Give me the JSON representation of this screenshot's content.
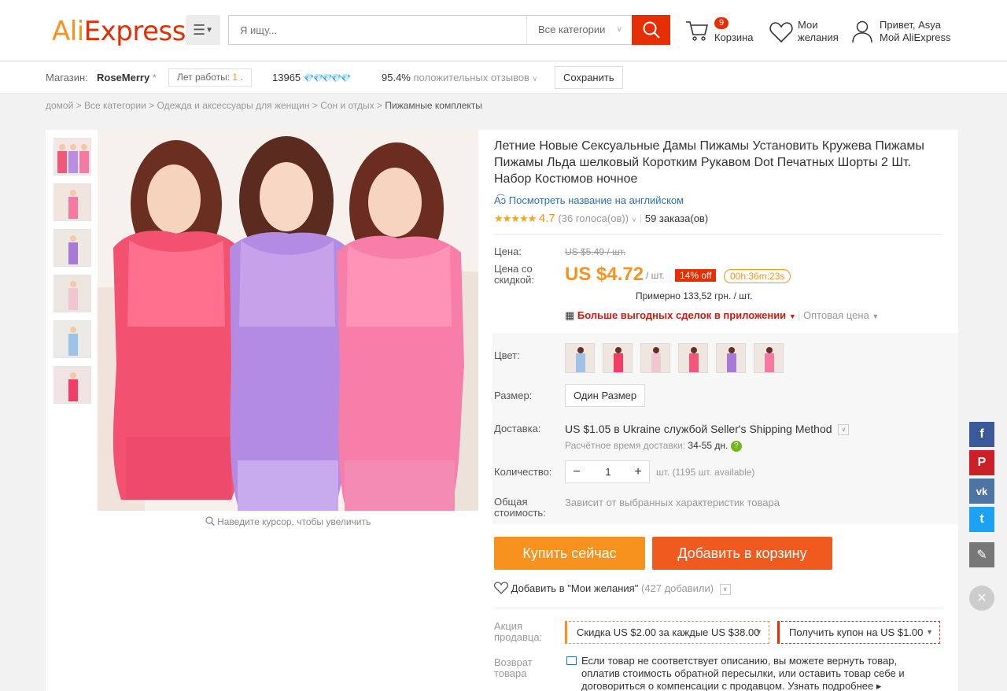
{
  "header": {
    "logo_ali": "Ali",
    "logo_express": "Express",
    "logo_tm": "™",
    "search_placeholder": "Я ищу...",
    "search_category": "Все категории",
    "cart_count": "9",
    "cart_label": "Корзина",
    "wishlist_line1": "Мои",
    "wishlist_line2": "желания",
    "account_line1": "Привет, Asya",
    "account_line2": "Мой AliExpress"
  },
  "store": {
    "label": "Магазин:",
    "name": "RoseMerry",
    "star": "*",
    "years_label": "Лет работы:",
    "years_value": "1",
    "years_dot": ".",
    "score": "13965",
    "diamonds": "💎💎💎💎💎",
    "positive": "95.4%",
    "positive_label": "положительных отзывов",
    "save_label": "Сохранить"
  },
  "breadcrumb": [
    "домой",
    "Все категории",
    "Одежда и аксессуары для женщин",
    "Сон и отдых",
    "Пижамные комплекты"
  ],
  "gallery": {
    "zoom_hint": "Наведите курсор, чтобы увеличить"
  },
  "product": {
    "title": "Летние Новые Сексуальные Дамы Пижамы Установить Кружева Пижамы Пижамы Льда шелковый Коротким Рукавом Dot Печатных Шорты 2 Шт. Набор Костюмов ночное",
    "translate_link": "Посмотреть название на английском",
    "stars": "★★★★★",
    "rating": "4.7",
    "votes": "(36 голоса(ов))",
    "orders": "59 заказа(ов)",
    "price_label": "Цена:",
    "old_price": "US $5.49 / шт.",
    "discount_label_1": "Цена со",
    "discount_label_2": "скидкой:",
    "new_price": "US $4.72",
    "per_unit": "/ шт.",
    "discount": "14% off",
    "timer": "00h:36m:23s",
    "approx": "Примерно 133,52 грн. / шт.",
    "app_deals": "Больше выгодных сделок в приложении",
    "wholesale": "Оптовая цена",
    "color_label": "Цвет:",
    "size_label": "Размер:",
    "size_value": "Один Размер",
    "shipping_label": "Доставка:",
    "shipping_text": "US $1.05 в Ukraine службой Seller's Shipping Method",
    "ship_time_label": "Расчётное время доставки:",
    "ship_time_value": "34-55 дн.",
    "qty_label": "Количество:",
    "qty_value": "1",
    "qty_note": "шт. (1195 шт. available)",
    "total_label_1": "Общая",
    "total_label_2": "стоимость:",
    "total_note": "Зависит от выбранных характеристик товара",
    "buy_now": "Купить сейчас",
    "add_cart": "Добавить в корзину",
    "wishlist_add": "Добавить в \"Мои желания\"",
    "wishlist_count": "(427 добавили)",
    "promo_label_1": "Акция",
    "promo_label_2": "продавца:",
    "promo1": "Скидка US $2.00 за каждые US $38.00",
    "promo2": "Получить купон на US $1.00",
    "return_label_1": "Возврат",
    "return_label_2": "товара",
    "return_text": "Если товар не соответствует описанию, вы можете вернуть товар, оплатив стоимость обратной пересылки, или оставить товар себе и договориться о компенсации с продавцом. Узнать подробнее ▸"
  },
  "social": {
    "facebook": "f",
    "pinterest": "P",
    "vk": "vk",
    "twitter": "t"
  },
  "colors": {
    "brand_red": "#e62e04",
    "brand_orange": "#f7931e",
    "buy_now": "#f7921e",
    "add_cart": "#f05a1f",
    "facebook": "#3b5998",
    "pinterest": "#cb2027",
    "vk": "#4c75a3",
    "twitter": "#1da1f2"
  }
}
